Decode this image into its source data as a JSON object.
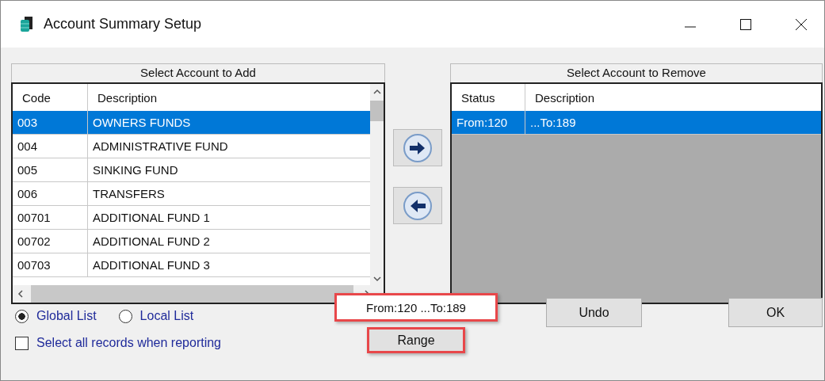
{
  "window": {
    "title": "Account Summary Setup"
  },
  "add_panel": {
    "title": "Select Account to Add",
    "columns": [
      "Code",
      "Description"
    ],
    "rows": [
      {
        "code": "003",
        "description": "OWNERS FUNDS",
        "selected": true
      },
      {
        "code": "004",
        "description": "ADMINISTRATIVE FUND",
        "selected": false
      },
      {
        "code": "005",
        "description": "SINKING FUND",
        "selected": false
      },
      {
        "code": "006",
        "description": "TRANSFERS",
        "selected": false
      },
      {
        "code": "00701",
        "description": "ADDITIONAL FUND 1",
        "selected": false
      },
      {
        "code": "00702",
        "description": "ADDITIONAL FUND 2",
        "selected": false
      },
      {
        "code": "00703",
        "description": "ADDITIONAL FUND 3",
        "selected": false
      }
    ]
  },
  "remove_panel": {
    "title": "Select Account to Remove",
    "columns": [
      "Status",
      "Description"
    ],
    "rows": [
      {
        "status": "From:120",
        "description": "...To:189",
        "selected": true
      }
    ]
  },
  "list_options": [
    {
      "label": "Global List",
      "selected": true
    },
    {
      "label": "Local List",
      "selected": false
    }
  ],
  "select_all": {
    "label": "Select all records when reporting",
    "checked": false
  },
  "range_field": {
    "value": "From:120 ...To:189"
  },
  "buttons": {
    "range": "Range",
    "undo": "Undo",
    "ok": "OK"
  }
}
